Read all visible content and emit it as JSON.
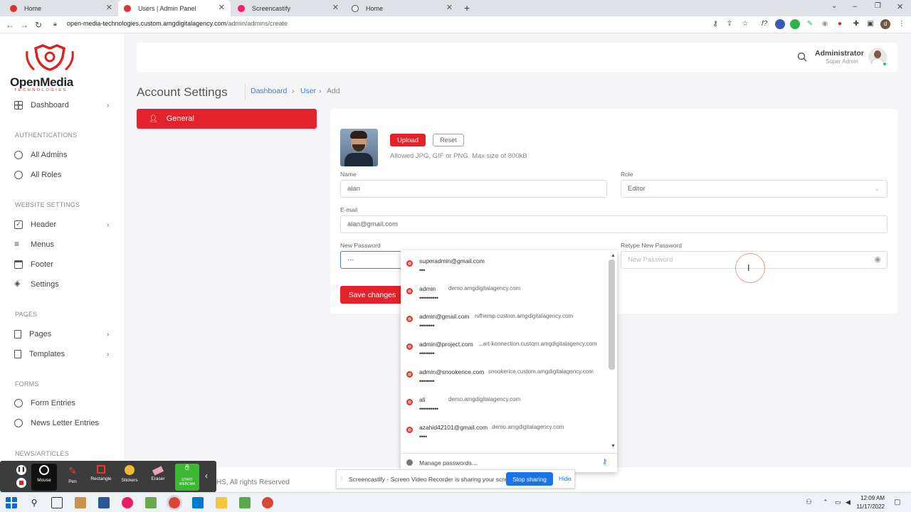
{
  "browser": {
    "tabs": [
      {
        "title": "Home",
        "color": "#d33"
      },
      {
        "title": "Users | Admin Panel",
        "color": "#d33"
      },
      {
        "title": "Screencastify",
        "color": "#e26"
      },
      {
        "title": "Home",
        "color": "#444"
      }
    ],
    "url_host": "open-media-technologies.custom.amgdigitalagency.com",
    "url_path": "/admin/admins/create"
  },
  "sidebar": {
    "brand": "OpenMedia",
    "brand_sub": "TECHNOLOGIES",
    "dashboard": "Dashboard",
    "sections": {
      "auth": "AUTHENTICATIONS",
      "website": "WEBSITE SETTINGS",
      "pages": "PAGES",
      "forms": "FORMS",
      "news": "NEWS/ARTICLES"
    },
    "items": {
      "all_admins": "All Admins",
      "all_roles": "All Roles",
      "header": "Header",
      "menus": "Menus",
      "footer": "Footer",
      "settings": "Settings",
      "pages": "Pages",
      "templates": "Templates",
      "form_entries": "Form Entries",
      "newsletter": "News Letter Entries"
    }
  },
  "header": {
    "user_name": "Administrator",
    "user_role": "Super Admin"
  },
  "page": {
    "title": "Account Settings",
    "breadcrumb": [
      "Dashboard",
      "User",
      "Add"
    ],
    "tab_general": "General"
  },
  "form": {
    "upload": "Upload",
    "reset": "Reset",
    "hint": "Allowed JPG, GIF or PNG. Max size of 800kB",
    "name_label": "Name",
    "name_value": "alan",
    "role_label": "Role",
    "role_value": "Editor",
    "email_label": "E-mail",
    "email_value": "alan@gmail.com",
    "password_label": "New Password",
    "password_value": "···",
    "retype_label": "Retype New Password",
    "retype_placeholder": "New Password",
    "save": "Save changes"
  },
  "autofill": {
    "items": [
      {
        "user": "superadmin@gmail.com",
        "site": "",
        "pass": "•••"
      },
      {
        "user": "admin",
        "site": "demo.amgdigitalagency.com",
        "pass": "••••••••••"
      },
      {
        "user": "admin@gmail.com",
        "site": "rvfhemp.custom.amgdigitalagency.com",
        "pass": "••••••••"
      },
      {
        "user": "admin@project.com",
        "site": "...art-konnection.custom.amgdigitalagency.com",
        "pass": "••••••••"
      },
      {
        "user": "admin@snookerice.com",
        "site": "snookerice.custom.amgdigitalagency.com",
        "pass": "••••••••"
      },
      {
        "user": "ali",
        "site": "demo.amgdigitalagency.com",
        "pass": "••••••••••"
      },
      {
        "user": "azahid42101@gmail.com",
        "site": "demo.amgdigitalagency.com",
        "pass": "••••"
      }
    ],
    "manage": "Manage passwords..."
  },
  "footer_text": "HS, All rights Reserved",
  "recorder": {
    "tools": [
      "Mouse",
      "Pen",
      "Rectangle",
      "Stickers",
      "Eraser",
      "START WEBCAM"
    ]
  },
  "share_bar": {
    "message": "Screencastify - Screen Video Recorder is sharing your screen.",
    "stop": "Stop sharing",
    "hide": "Hide"
  },
  "taskbar": {
    "time": "12:09 AM",
    "date": "11/17/2022"
  }
}
